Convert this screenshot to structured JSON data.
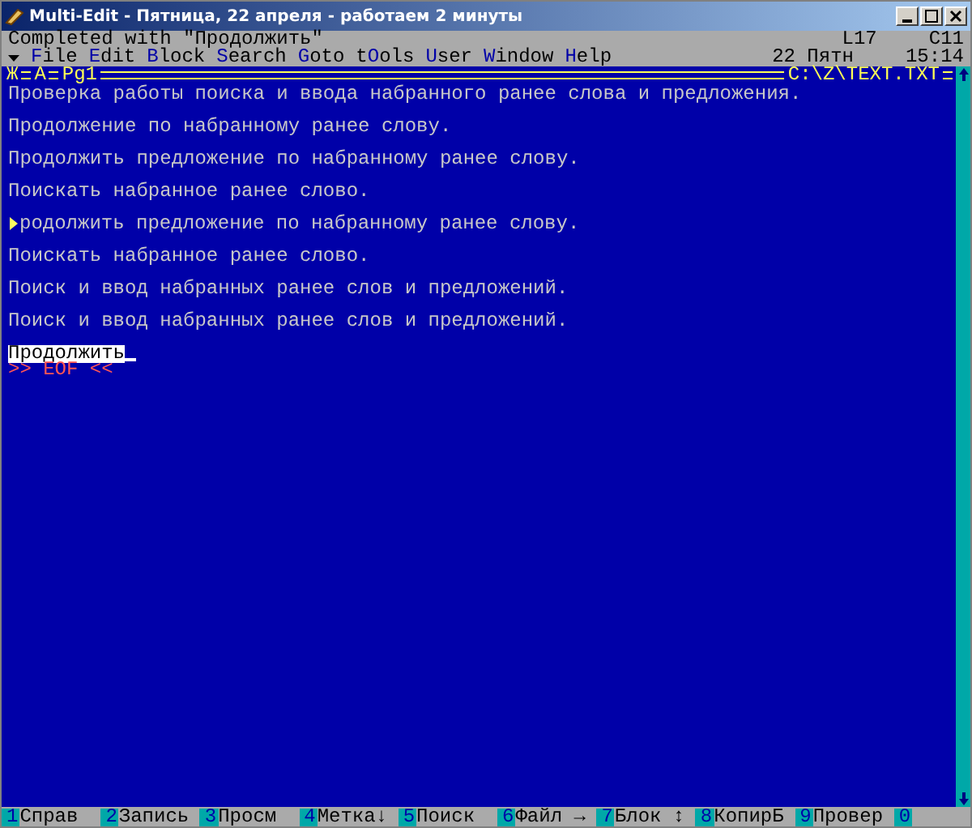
{
  "window": {
    "title": "Multi-Edit - Пятница, 22 апреля - работаем 2 минуты"
  },
  "status": {
    "message": "Completed with \"Продолжить\"",
    "line": "L17",
    "column": "C11"
  },
  "menu": [
    {
      "key": "F",
      "after": "ile"
    },
    {
      "key": "E",
      "after": "dit"
    },
    {
      "key": "B",
      "after": "lock"
    },
    {
      "key": "S",
      "after": "earch"
    },
    {
      "key": "G",
      "after": "oto"
    },
    {
      "before": "t",
      "key": "O",
      "after": "ols"
    },
    {
      "key": "U",
      "after": "ser"
    },
    {
      "key": "W",
      "after": "indow"
    },
    {
      "key": "H",
      "after": "elp"
    }
  ],
  "clock": {
    "date": "22 Пятн",
    "time": "15:14"
  },
  "editor": {
    "window_marker": "Ж",
    "drive": "A",
    "page": "Pg1",
    "file": "C:\\Z\\TEXT.TXT",
    "lines": [
      {
        "kind": "normal",
        "text": "Проверка работы поиска и ввода набранного ранее слова и предложения."
      },
      {
        "kind": "normal",
        "text": "Продолжение по набранному ранее слову."
      },
      {
        "kind": "normal",
        "text": "Продолжить предложение по набранному ранее слову."
      },
      {
        "kind": "normal",
        "text": "Поискать набранное ранее слово."
      },
      {
        "kind": "marked",
        "text": "родолжить предложение по набранному ранее слову."
      },
      {
        "kind": "normal",
        "text": "Поискать набранное ранее слово."
      },
      {
        "kind": "normal",
        "text": "Поиск и ввод набранных ранее слов и предложений."
      },
      {
        "kind": "normal",
        "text": "Поиск и ввод набранных ранее слов и предложений."
      },
      {
        "kind": "highlighted",
        "text": "Продолжить"
      }
    ],
    "eof": ">> EOF <<"
  },
  "function_keys": [
    {
      "key": "1",
      "label": "Справ"
    },
    {
      "key": "2",
      "label": "Запись"
    },
    {
      "key": "3",
      "label": "Просм"
    },
    {
      "key": "4",
      "label": "Метка↓"
    },
    {
      "key": "5",
      "label": "Поиск"
    },
    {
      "key": "6",
      "label": "Файл →"
    },
    {
      "key": "7",
      "label": "Блок ↕"
    },
    {
      "key": "8",
      "label": "КопирБ"
    },
    {
      "key": "9",
      "label": "Провер"
    },
    {
      "key": "0"
    }
  ]
}
